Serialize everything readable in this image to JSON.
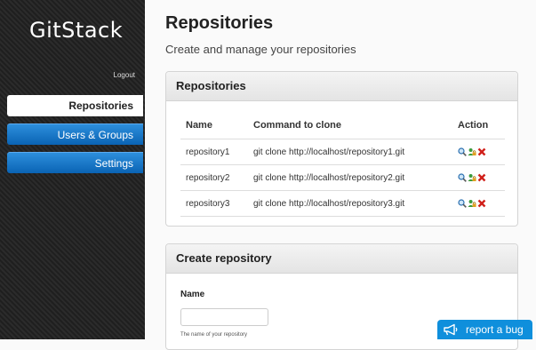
{
  "sidebar": {
    "logo": "GitStack",
    "logout": "Logout",
    "items": [
      {
        "label": "Repositories"
      },
      {
        "label": "Users & Groups"
      },
      {
        "label": "Settings"
      }
    ]
  },
  "main": {
    "title": "Repositories",
    "subtitle": "Create and manage your repositories",
    "repos_panel": {
      "title": "Repositories",
      "columns": [
        "Name",
        "Command to clone",
        "Action"
      ],
      "rows": [
        {
          "name": "repository1",
          "command": "git clone http://localhost/repository1.git"
        },
        {
          "name": "repository2",
          "command": "git clone http://localhost/repository2.git"
        },
        {
          "name": "repository3",
          "command": "git clone http://localhost/repository3.git"
        }
      ],
      "action_icons": [
        "magnifier-icon",
        "user-lock-icon",
        "delete-x-icon"
      ]
    },
    "create_panel": {
      "title": "Create repository",
      "name_label": "Name",
      "name_value": "",
      "help_text": "The name of your repository"
    }
  },
  "report_bug": {
    "label": "report a bug",
    "icon": "megaphone-icon"
  },
  "colors": {
    "nav_blue": "#0a63b4",
    "report_bug_blue": "#0f8fdc",
    "delete_red": "#d0201a"
  }
}
